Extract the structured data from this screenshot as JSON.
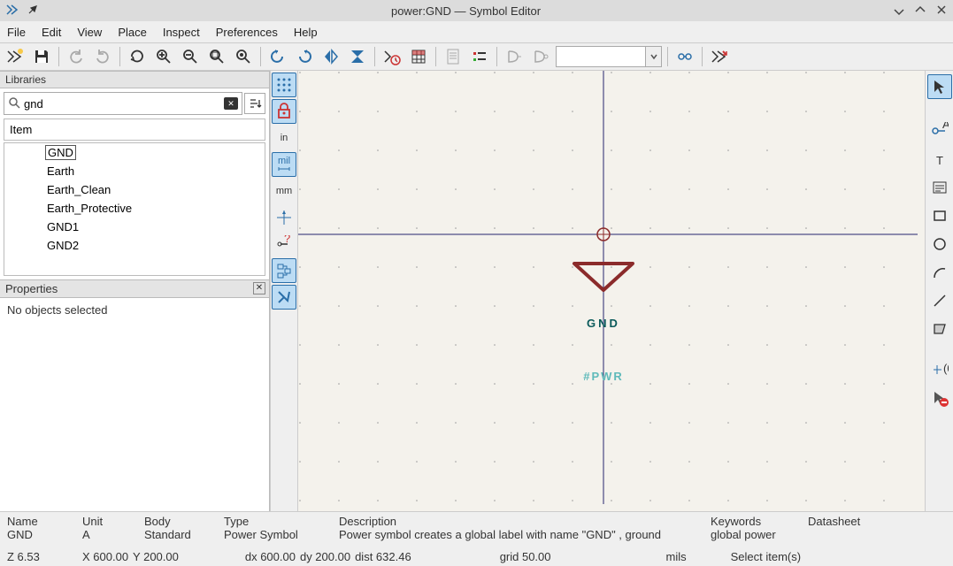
{
  "window": {
    "title": "power:GND — Symbol Editor"
  },
  "menu": {
    "file": "File",
    "edit": "Edit",
    "view": "View",
    "place": "Place",
    "inspect": "Inspect",
    "preferences": "Preferences",
    "help": "Help"
  },
  "left_vtb": {
    "in": "in",
    "mil": "mil",
    "mm": "mm"
  },
  "libraries": {
    "panel_title": "Libraries",
    "search_value": "gnd",
    "item_header": "Item",
    "items": [
      "GND",
      "Earth",
      "Earth_Clean",
      "Earth_Protective",
      "GND1",
      "GND2"
    ]
  },
  "properties": {
    "panel_title": "Properties",
    "body_text": "No objects selected"
  },
  "canvas": {
    "symbol_name": "GND",
    "symbol_ref": "#PWR"
  },
  "status_row1": {
    "name_label": "Name",
    "name_val": "GND",
    "unit_label": "Unit",
    "unit_val": "A",
    "body_label": "Body",
    "body_val": "Standard",
    "type_label": "Type",
    "type_val": "Power Symbol",
    "desc_label": "Description",
    "desc_val": "Power symbol creates a global label with name \"GND\" , ground",
    "keywords_label": "Keywords",
    "keywords_val": "global power",
    "datasheet_label": "Datasheet",
    "datasheet_val": ""
  },
  "status_row2": {
    "z": "Z 6.53",
    "x": "X 600.00",
    "y": "Y 200.00",
    "dx": "dx 600.00",
    "dy": "dy 200.00",
    "dist": "dist 632.46",
    "grid": "grid 50.00",
    "units": "mils",
    "mode": "Select item(s)"
  }
}
